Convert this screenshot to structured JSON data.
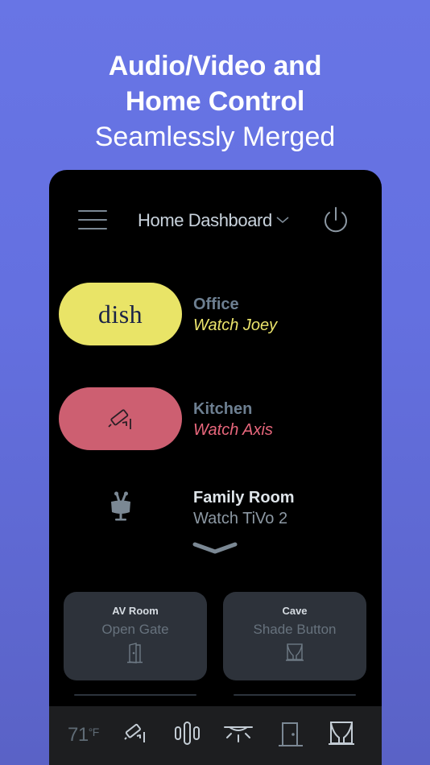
{
  "headline": {
    "line1": "Audio/Video and",
    "line2": "Home Control",
    "line3": "Seamlessly Merged"
  },
  "app": {
    "header": {
      "title": "Home Dashboard",
      "menu_icon": "hamburger-menu-icon",
      "dropdown_icon": "chevron-down-icon",
      "power_icon": "power-icon"
    },
    "sources": [
      {
        "room": "Office",
        "action": "Watch Joey",
        "icon": "dish-logo",
        "logo_text": "dish",
        "color": "#e9e467",
        "action_color": "#ece56c"
      },
      {
        "room": "Kitchen",
        "action": "Watch Axis",
        "icon": "security-camera-icon",
        "color": "#cd5f71",
        "action_color": "#e8677c"
      },
      {
        "room": "Family Room",
        "action": "Watch TiVo 2",
        "icon": "tivo-icon",
        "color": null,
        "action_color": "#8c98a3"
      }
    ],
    "expand_icon": "chevron-down-icon",
    "tiles": [
      {
        "room": "AV Room",
        "action": "Open Gate",
        "icon": "door-icon"
      },
      {
        "room": "Cave",
        "action": "Shade Button",
        "icon": "curtain-icon"
      }
    ],
    "bottom_bar": {
      "temperature": "71",
      "unit": "°F",
      "icons": [
        "security-camera-icon",
        "audio-bars-icon",
        "ceiling-light-icon",
        "door-icon",
        "curtain-icon"
      ]
    }
  }
}
